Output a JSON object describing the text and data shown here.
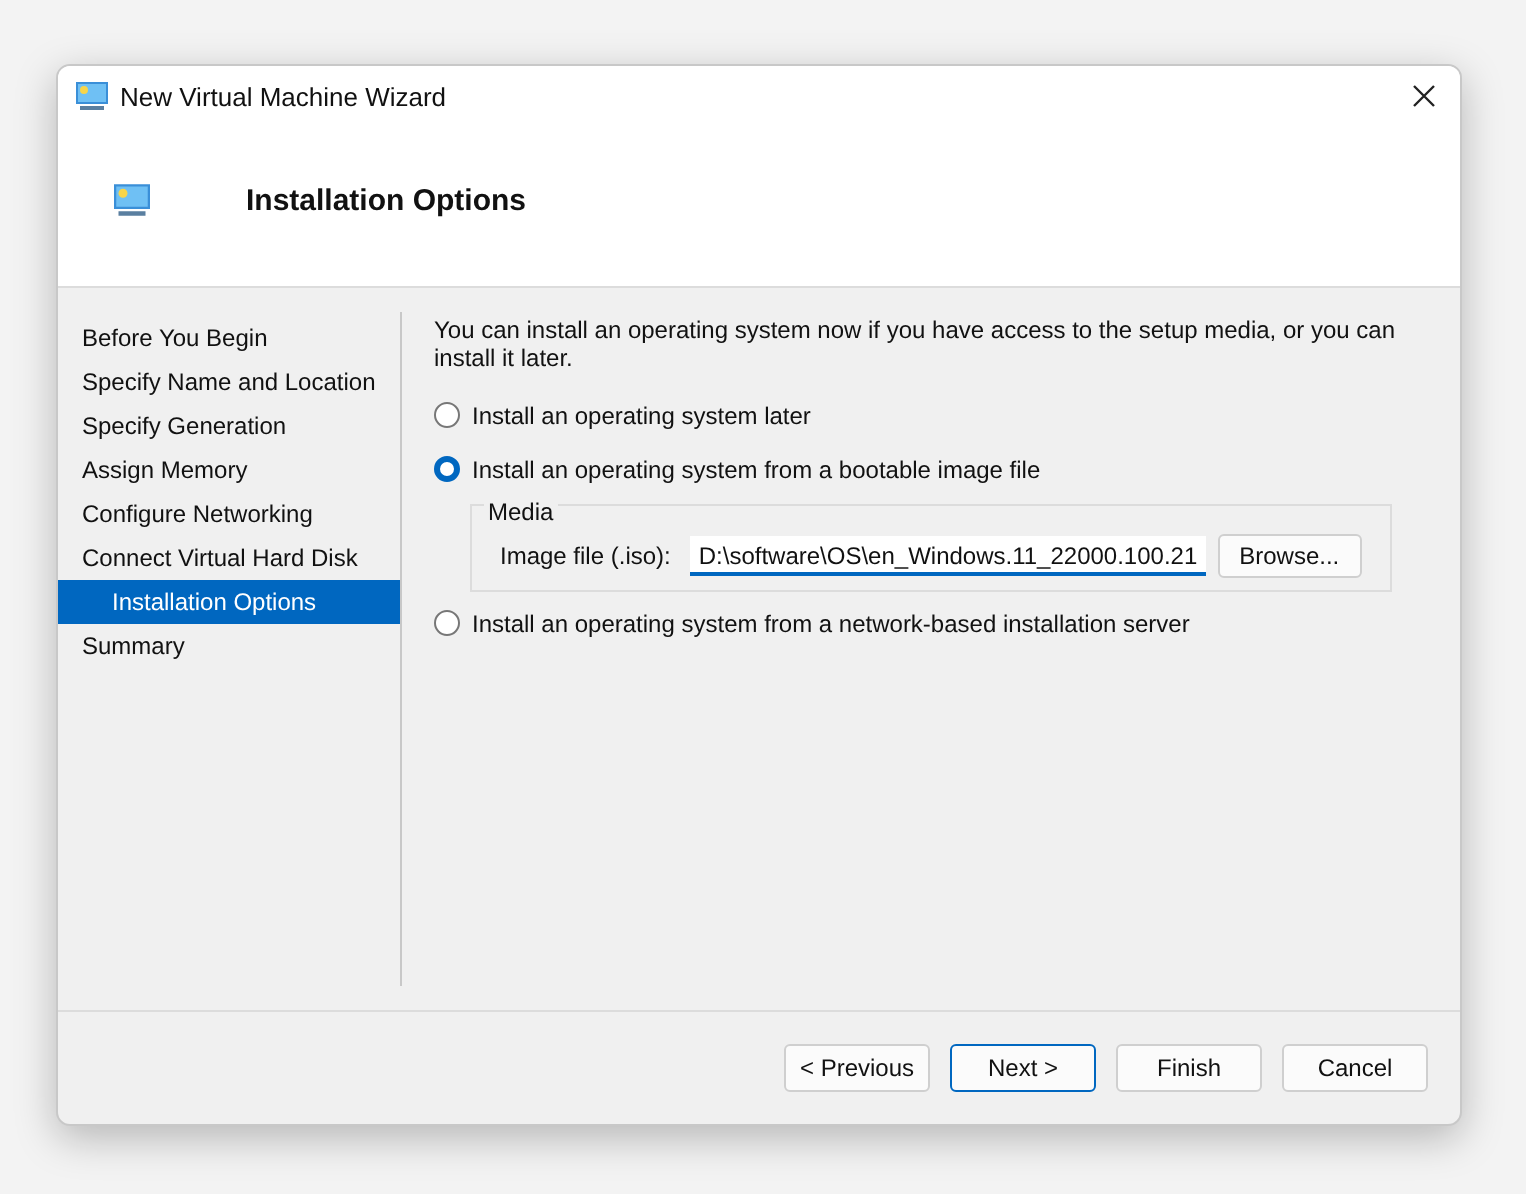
{
  "window": {
    "title": "New Virtual Machine Wizard"
  },
  "header": {
    "title": "Installation Options"
  },
  "sidebar": {
    "items": [
      {
        "label": "Before You Begin",
        "selected": false
      },
      {
        "label": "Specify Name and Location",
        "selected": false
      },
      {
        "label": "Specify Generation",
        "selected": false
      },
      {
        "label": "Assign Memory",
        "selected": false
      },
      {
        "label": "Configure Networking",
        "selected": false
      },
      {
        "label": "Connect Virtual Hard Disk",
        "selected": false
      },
      {
        "label": "Installation Options",
        "selected": true
      },
      {
        "label": "Summary",
        "selected": false
      }
    ]
  },
  "intro": "You can install an operating system now if you have access to the setup media, or you can install it later.",
  "options": [
    {
      "label": "Install an operating system later",
      "selected": false
    },
    {
      "label": "Install an operating system from a bootable image file",
      "selected": true,
      "media": {
        "title": "Media",
        "field_label": "Image file (.iso):",
        "value": "D:\\software\\OS\\en_Windows.11_22000.100.21",
        "button": "Browse..."
      }
    },
    {
      "label": "Install an operating system from a network-based installation server",
      "selected": false
    }
  ],
  "buttons": [
    {
      "label": "< Previous",
      "focused": false
    },
    {
      "label": "Next >",
      "focused": true
    },
    {
      "label": "Finish",
      "focused": false
    },
    {
      "label": "Cancel",
      "focused": false
    }
  ]
}
